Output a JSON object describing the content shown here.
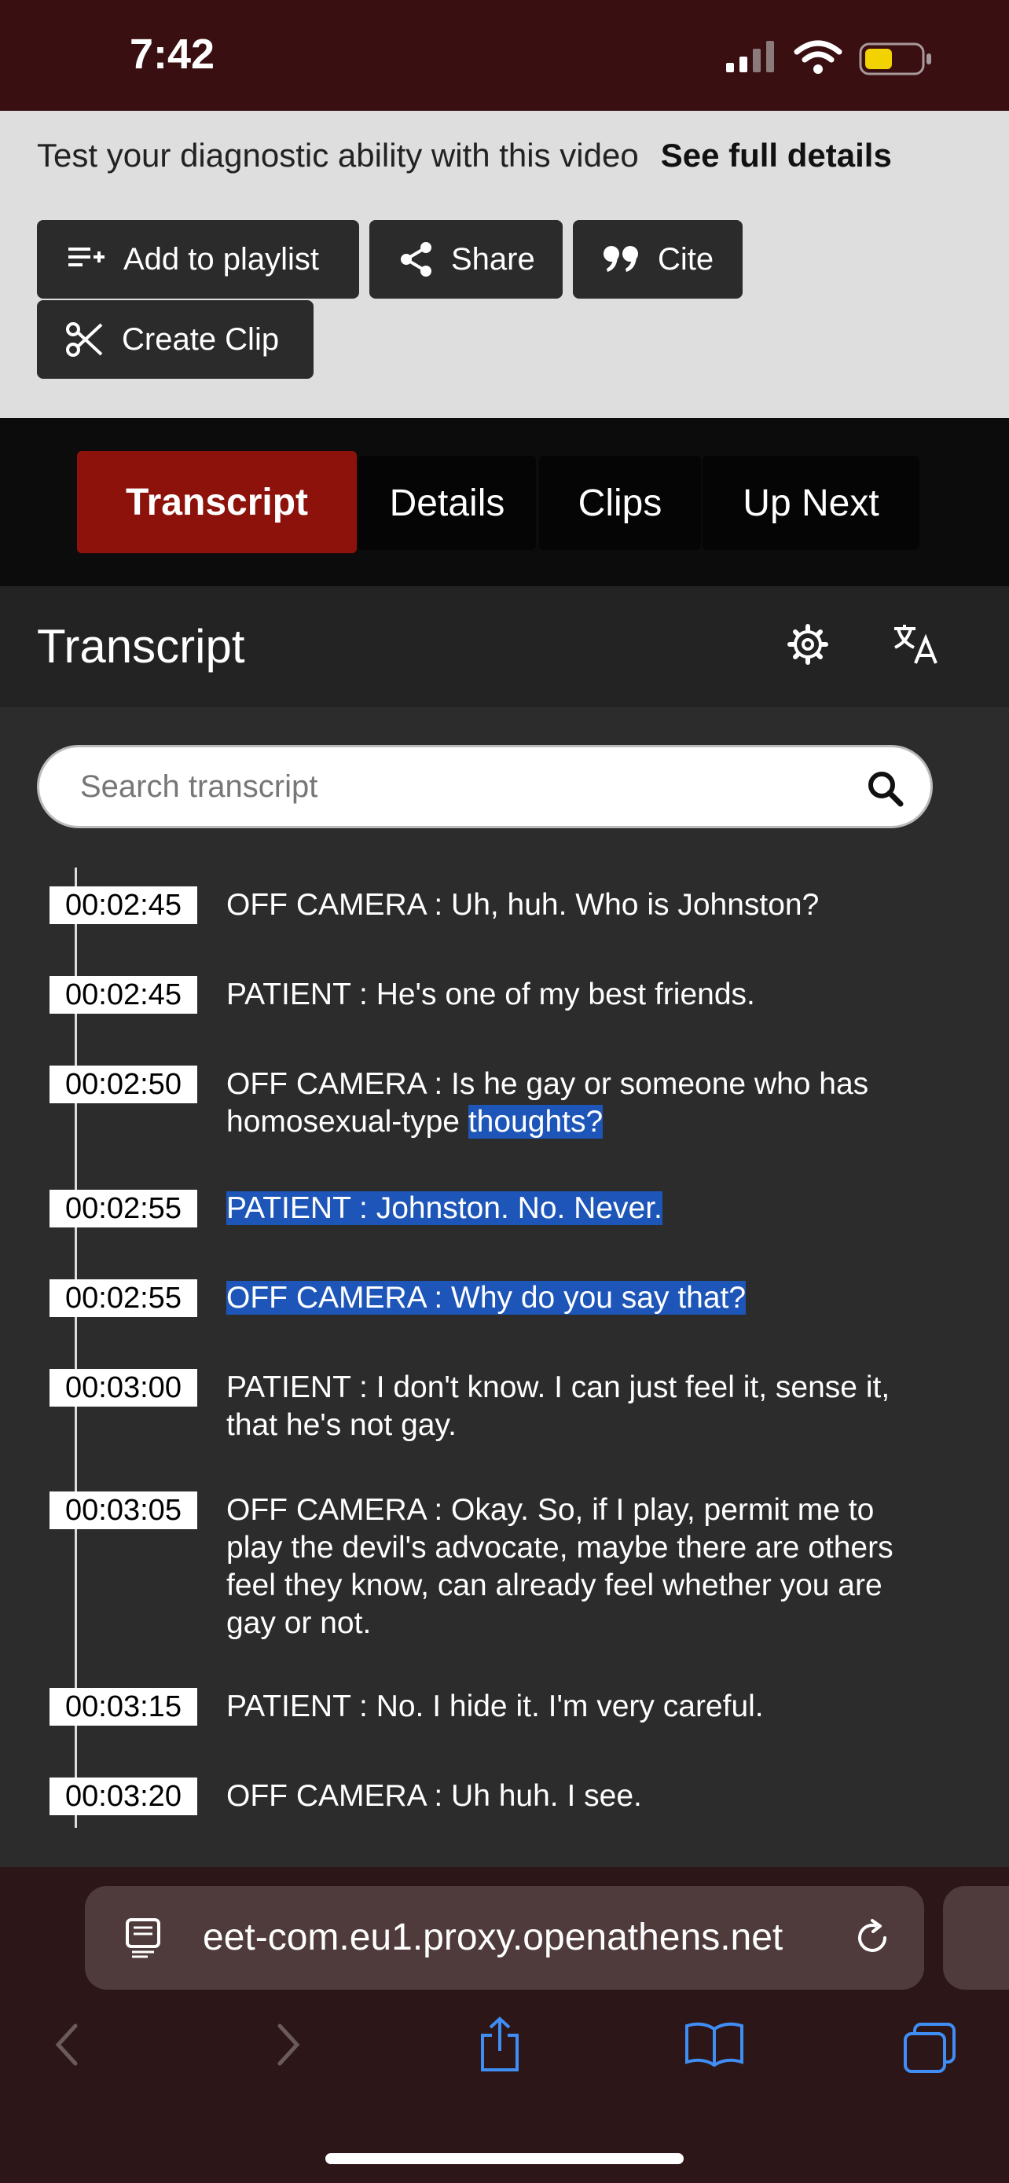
{
  "status": {
    "time": "7:42"
  },
  "intro": {
    "text": "Test your diagnostic ability with this video",
    "details_link": "See full details"
  },
  "actions": {
    "add_to_playlist": "Add to playlist",
    "share": "Share",
    "cite": "Cite",
    "create_clip": "Create Clip"
  },
  "tabs": [
    "Transcript",
    "Details",
    "Clips",
    "Up Next"
  ],
  "transcript": {
    "title": "Transcript",
    "search_placeholder": "Search transcript",
    "entries": [
      {
        "time": "00:02:45",
        "text": "OFF CAMERA : Uh, huh. Who is Johnston?"
      },
      {
        "time": "00:02:45",
        "text": "PATIENT : He's one of my best friends."
      },
      {
        "time": "00:02:50",
        "text_a": "OFF CAMERA : Is he gay or someone who has homosexual-type ",
        "text_b": "thoughts?"
      },
      {
        "time": "00:02:55",
        "text": "PATIENT : Johnston. No. Never."
      },
      {
        "time": "00:02:55",
        "text": "OFF CAMERA : Why do you say that?"
      },
      {
        "time": "00:03:00",
        "text": "PATIENT : I don't know. I can just feel it, sense it, that he's not gay."
      },
      {
        "time": "00:03:05",
        "text": "OFF CAMERA : Okay. So, if I play, permit me to play the devil's advocate, maybe there are others feel they know, can already feel whether you are gay or not."
      },
      {
        "time": "00:03:15",
        "text": "PATIENT : No. I hide it. I'm very careful."
      },
      {
        "time": "00:03:20",
        "text": "OFF CAMERA : Uh huh. I see."
      }
    ]
  },
  "browser": {
    "url": "eet-com.eu1.proxy.openathens.net"
  },
  "colors": {
    "accent": "#8e120c",
    "highlight": "#1d56b8",
    "status_bg": "#3a0f11"
  }
}
